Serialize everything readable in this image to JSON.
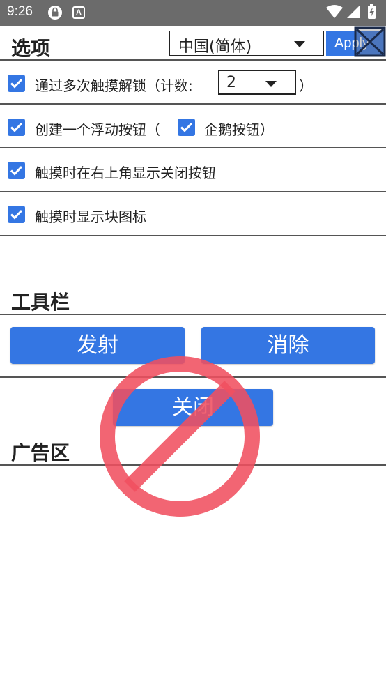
{
  "status_bar": {
    "time": "9:26"
  },
  "options": {
    "title": "选项",
    "language_value": "中国(简体)",
    "apply_label": "Apply"
  },
  "rows": {
    "unlock_text": "通过多次触摸解锁（计数:",
    "unlock_count": "2",
    "unlock_close_paren": "）",
    "float_text": "创建一个浮动按钮（",
    "penguin_text": "企鹅按钮）",
    "close_top_right_text": "触摸时在右上角显示关闭按钮",
    "show_block_icon_text": "触摸时显示块图标"
  },
  "toolbar": {
    "title": "工具栏",
    "launch_label": "发射",
    "clear_label": "消除",
    "close_label": "关闭"
  },
  "ad": {
    "title": "广告区"
  },
  "colors": {
    "accent": "#3476e3",
    "status_bar": "#6b6b6b",
    "prohibit": "#f05060"
  }
}
